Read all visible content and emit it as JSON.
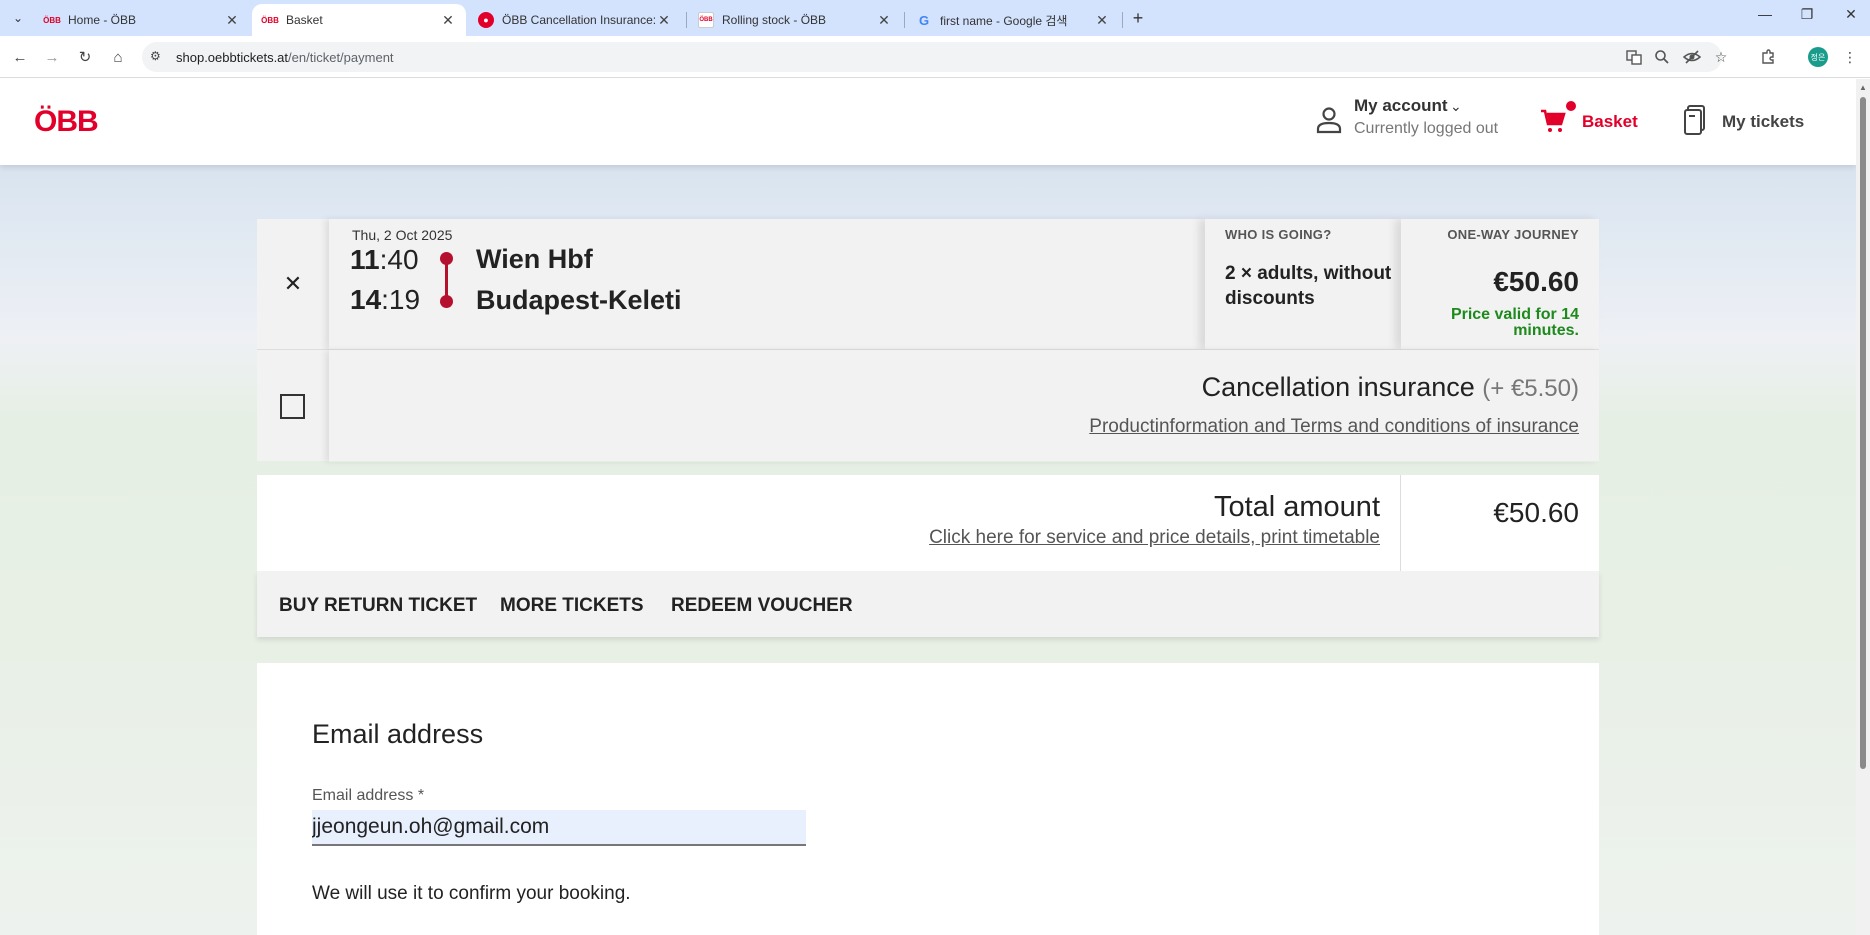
{
  "browser": {
    "tabs": [
      {
        "title": "Home - ÖBB",
        "favicon": "obb-logo-icon",
        "active": false
      },
      {
        "title": "Basket",
        "favicon": "obb-logo-icon",
        "active": true
      },
      {
        "title": "ÖBB Cancellation Insurance: P",
        "favicon": "obb-circle-icon",
        "active": false
      },
      {
        "title": "Rolling stock - ÖBB",
        "favicon": "obb-page-icon",
        "active": false
      },
      {
        "title": "first name - Google 검색",
        "favicon": "google-icon",
        "active": false
      }
    ],
    "url_host": "shop.oebbtickets.at",
    "url_path": "/en/ticket/payment"
  },
  "header": {
    "logo": "ÖBB",
    "account_title": "My account",
    "account_status": "Currently logged out",
    "basket_label": "Basket",
    "tickets_label": "My tickets"
  },
  "journey": {
    "date": "Thu, 2 Oct 2025",
    "departure_hour": "11",
    "departure_min": ":40",
    "arrival_hour": "14",
    "arrival_min": ":19",
    "from": "Wien Hbf",
    "to": "Budapest-Keleti",
    "who_label": "WHO IS GOING?",
    "passengers": "2 × adults, without discounts",
    "journey_type": "ONE-WAY JOURNEY",
    "price": "€50.60",
    "price_validity": "Price valid for 14 minutes."
  },
  "insurance": {
    "title": "Cancellation insurance",
    "price": "(+ €5.50)",
    "link": "Productinformation and Terms and conditions of insurance",
    "checked": false
  },
  "total": {
    "label": "Total amount",
    "link": "Click here for service and price details, print timetable",
    "amount": "€50.60"
  },
  "actions": [
    "BUY RETURN TICKET",
    "MORE TICKETS",
    "REDEEM VOUCHER"
  ],
  "email": {
    "heading": "Email address",
    "label": "Email address *",
    "value": "jjeongeun.oh@gmail.com",
    "hint": "We will use it to confirm your booking."
  },
  "colors": {
    "brand": "#e2002a",
    "route": "#b5102d",
    "valid": "#1e8a1e"
  }
}
